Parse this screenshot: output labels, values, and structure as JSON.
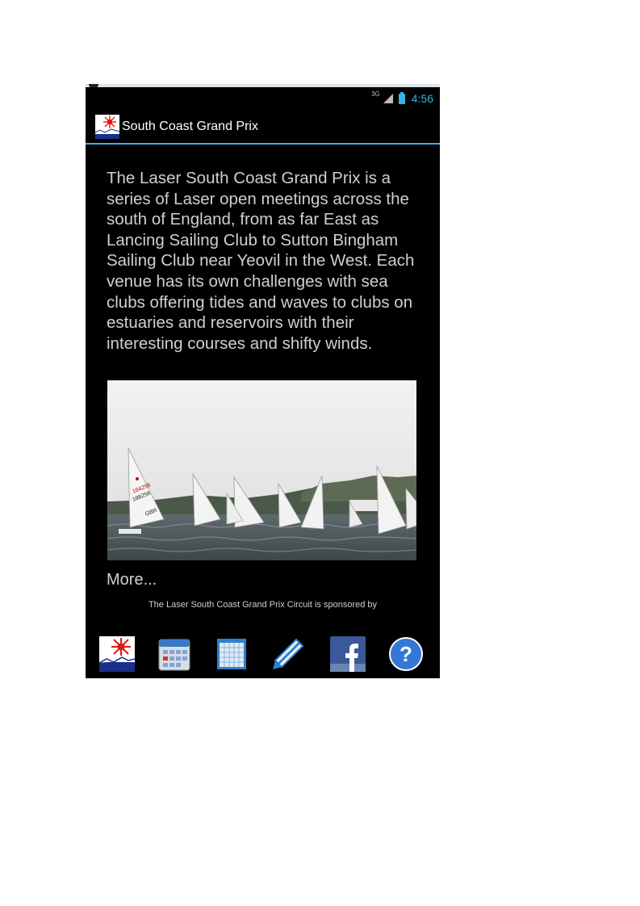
{
  "status_bar": {
    "network": "3G",
    "time": "4:56"
  },
  "action_bar": {
    "title": "South Coast Grand Prix",
    "logo_icon": "laser-logo-icon"
  },
  "content": {
    "intro_text": "The Laser South Coast Grand Prix is a series of Laser open meetings across the south of England, from as far East as Lancing Sailing Club to Sutton Bingham Sailing Club near Yeovil in the West. Each venue has its own challenges with sea clubs offering tides and waves to clubs on estuaries and reservoirs with their interesting courses and shifty winds.",
    "more_link": "More...",
    "sponsor_text": "The Laser South Coast Grand Prix Circuit is sponsored by"
  },
  "photo": {
    "description_icon": "sailing-race-photo",
    "sail_numbers": [
      "188258",
      "GBR",
      "184258"
    ]
  },
  "bottom_bar": {
    "icons": [
      "laser-logo-icon",
      "calendar-icon",
      "spreadsheet-icon",
      "pencil-icon",
      "facebook-icon",
      "help-icon"
    ]
  },
  "colors": {
    "accent": "#33b5e5",
    "background": "#000000",
    "text": "#cfcfcf"
  }
}
